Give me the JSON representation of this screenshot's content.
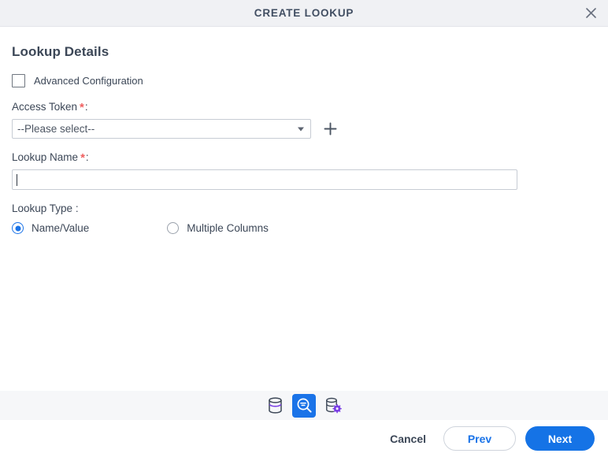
{
  "dialog": {
    "title": "CREATE LOOKUP",
    "close_icon": "close-icon"
  },
  "form": {
    "heading": "Lookup Details",
    "advanced_configuration": {
      "label": "Advanced Configuration",
      "checked": false
    },
    "access_token": {
      "label": "Access Token",
      "required_marker": "*",
      "colon": ":",
      "selected_value": "--Please select--",
      "add_icon": "plus-icon",
      "caret_icon": "chevron-down-icon"
    },
    "lookup_name": {
      "label": "Lookup Name",
      "required_marker": "*",
      "colon": ":",
      "value": "",
      "placeholder": ""
    },
    "lookup_type": {
      "label": "Lookup Type :",
      "options": [
        {
          "label": "Name/Value",
          "selected": true
        },
        {
          "label": "Multiple Columns",
          "selected": false
        }
      ]
    }
  },
  "icon_band": {
    "items": [
      {
        "icon": "database-icon",
        "active": false
      },
      {
        "icon": "database-search-icon",
        "active": true
      },
      {
        "icon": "database-settings-icon",
        "active": false
      }
    ]
  },
  "footer": {
    "cancel_label": "Cancel",
    "prev_label": "Prev",
    "next_label": "Next"
  },
  "colors": {
    "accent": "#1a73e8",
    "next_button": "#1573e6",
    "required_star": "#f06060",
    "titlebar_bg": "#f0f1f4",
    "band_bg": "#f6f7f9",
    "purple_accent": "#7b3fe4",
    "text": "#3c4757"
  }
}
